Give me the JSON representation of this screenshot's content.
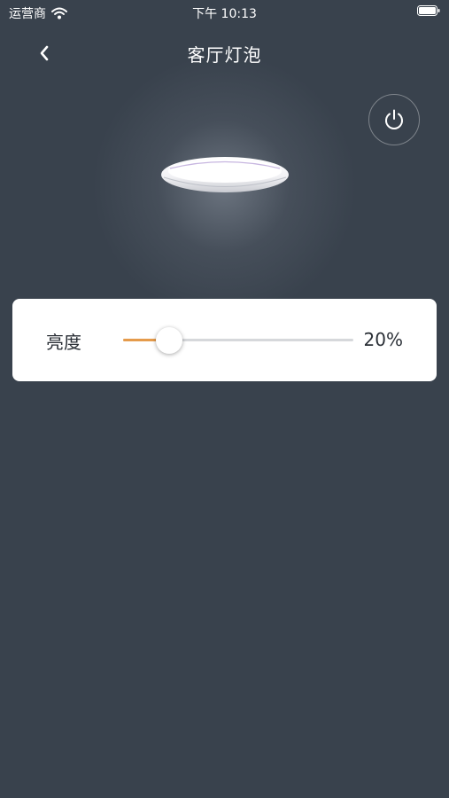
{
  "status_bar": {
    "carrier": "运营商",
    "time": "下午 10:13",
    "icons": [
      "wifi-icon",
      "battery-icon"
    ]
  },
  "header": {
    "title": "客厅灯泡",
    "back_icon": "chevron-left-icon"
  },
  "device": {
    "image": "ceiling-lamp-icon",
    "power_icon": "power-icon"
  },
  "brightness": {
    "label": "亮度",
    "value_text": "20%",
    "value": 0.2,
    "accent_color": "#e59b4b"
  },
  "colors": {
    "background": "#39424d",
    "card": "#ffffff"
  }
}
